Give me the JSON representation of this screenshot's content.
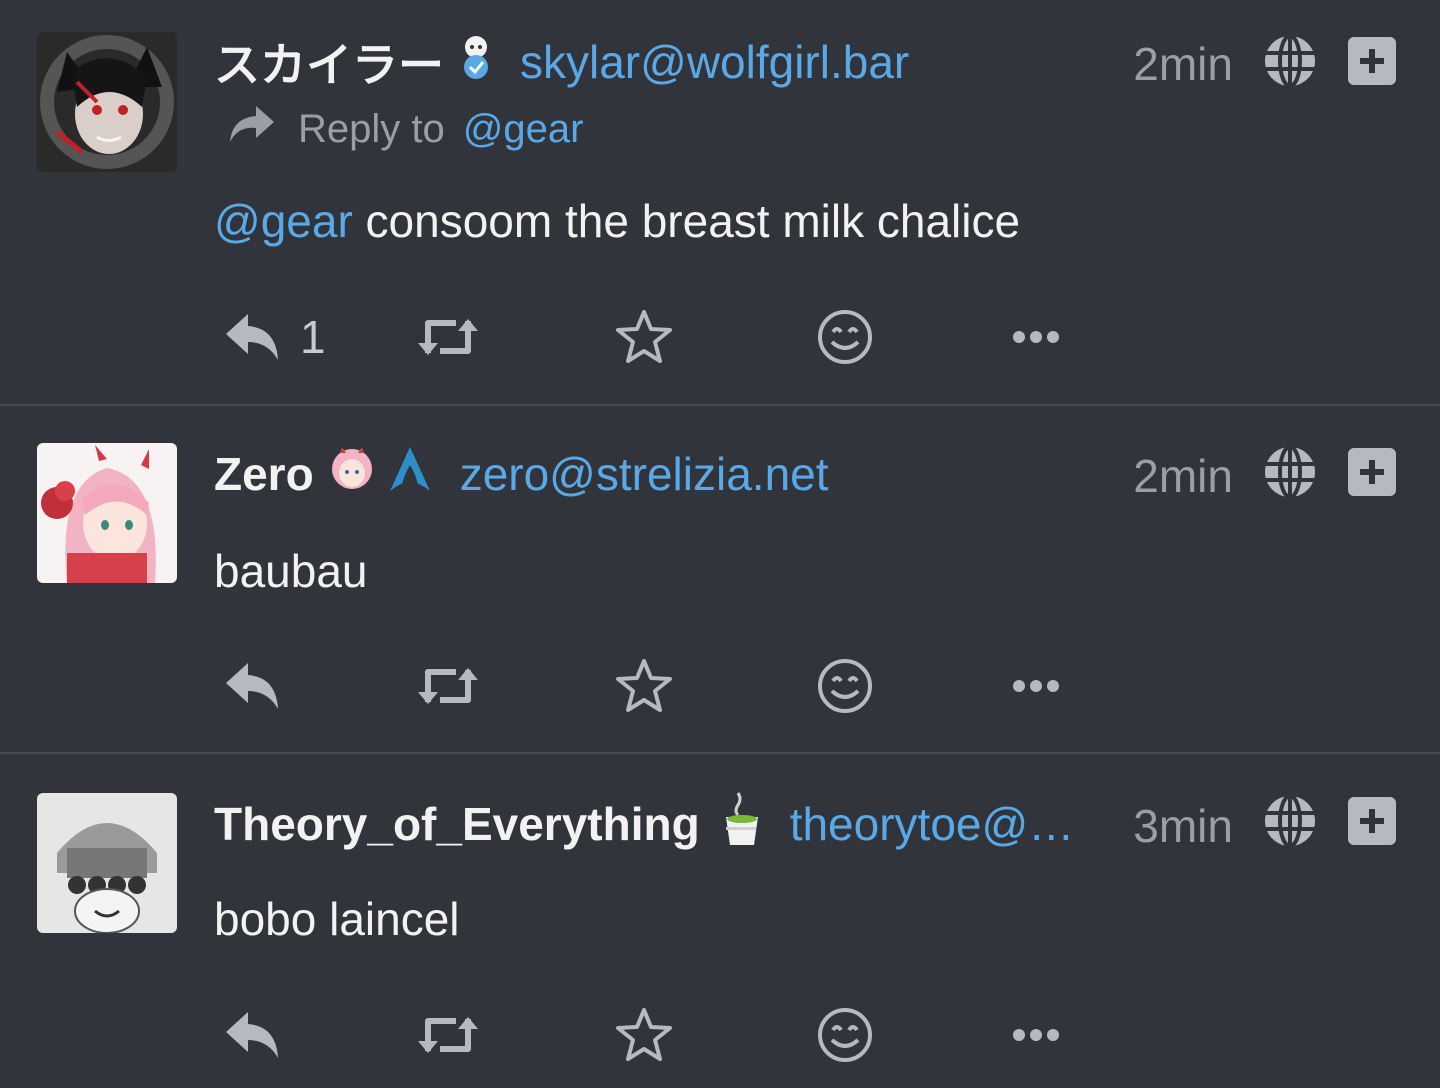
{
  "posts": [
    {
      "display_name": "スカイラー",
      "handle": "skylar@wolfgirl.bar",
      "time": "2min",
      "reply_label": "Reply to",
      "reply_to": "@gear",
      "content_mention": "@gear",
      "content_text": " consoom the breast milk chalice",
      "reply_count": "1",
      "name_emojis": [
        "verified-girl-emoji"
      ]
    },
    {
      "display_name": "Zero",
      "handle": "zero@strelizia.net",
      "time": "2min",
      "content_text": "baubau",
      "reply_count": "",
      "name_emojis": [
        "zero-two-emoji",
        "arch-linux-emoji"
      ]
    },
    {
      "display_name": "Theory_of_Everything",
      "handle": "theorytoe@a…",
      "time": "3min",
      "content_text": "bobo laincel",
      "reply_count": "",
      "name_emojis": [
        "green-tea-emoji"
      ]
    }
  ],
  "icons": {
    "visibility": "globe-icon",
    "expand": "plus-square-icon",
    "reply": "reply-icon",
    "repeat": "retweet-icon",
    "favorite": "star-icon",
    "react": "smile-icon",
    "more": "ellipsis-icon"
  },
  "colors": {
    "background": "#31343a",
    "link": "#5aa8e6",
    "muted": "#9a9ea6",
    "divider": "#464a52"
  }
}
